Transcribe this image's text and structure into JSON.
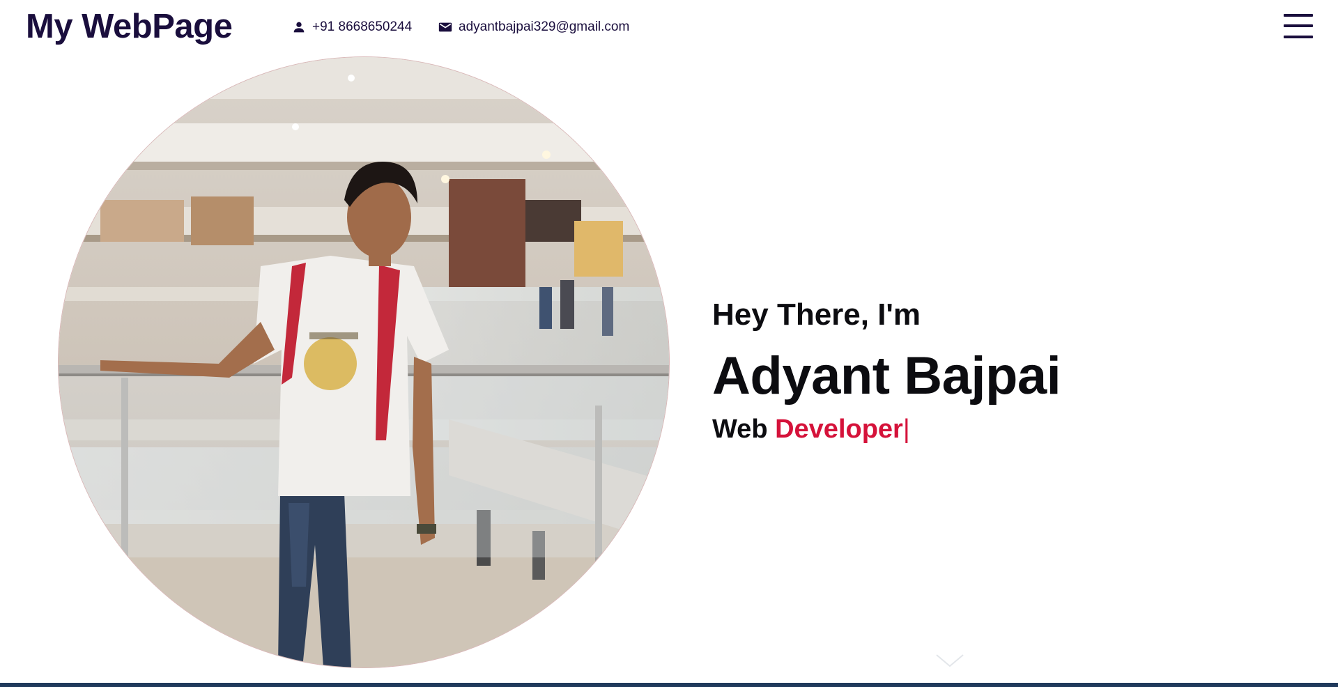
{
  "header": {
    "logo": "My WebPage",
    "phone": "+91 8668650244",
    "email": "adyantbajpai329@gmail.com",
    "phone_icon": "person-icon",
    "email_icon": "mail-icon",
    "menu_icon": "hamburger-menu-icon"
  },
  "hero": {
    "greeting": "Hey There, I'm",
    "name": "Adyant Bajpai",
    "role_prefix": "Web",
    "role_typed": "Developer",
    "cursor": "|",
    "scroll_icon": "chevron-down-icon",
    "photo_alt": "profile-photo"
  },
  "colors": {
    "primary": "#1a0e3d",
    "accent": "#d5123a",
    "text": "#0c0c10",
    "footer_line": "#203a5c"
  }
}
